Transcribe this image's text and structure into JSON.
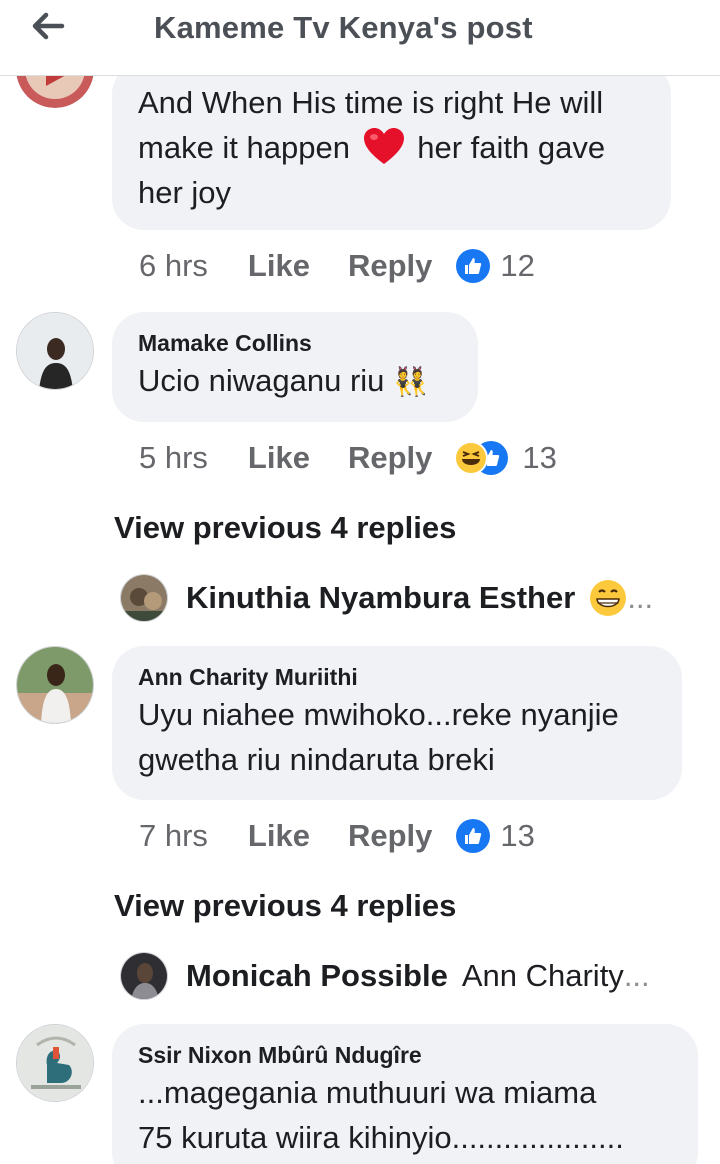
{
  "header": {
    "title": "Kameme Tv Kenya's post"
  },
  "comments": [
    {
      "text_lines": [
        "And When His time is right He will",
        "make it happen",
        "her faith gave",
        "her joy"
      ],
      "time": "6 hrs",
      "like": "Like",
      "reply": "Reply",
      "reaction_count": "12"
    },
    {
      "author": "Mamake Collins",
      "text": "Ucio niwaganu riu",
      "time": "5 hrs",
      "like": "Like",
      "reply": "Reply",
      "reaction_count": "13"
    },
    {
      "author": "Ann Charity Muriithi",
      "text_lines": [
        "Uyu niahee mwihoko...reke nyanjie",
        "gwetha riu nindaruta breki"
      ],
      "time": "7 hrs",
      "like": "Like",
      "reply": "Reply",
      "reaction_count": "13"
    },
    {
      "author": "Ssir Nixon Mbûrû Ndugîre",
      "text_lines": [
        "...magegania muthuuri wa miama",
        "75 kuruta wiira kihinyio...................."
      ]
    }
  ],
  "view_previous": [
    "View previous 4 replies",
    "View previous 4 replies"
  ],
  "reply_previews": [
    {
      "name": "Kinuthia Nyambura Esther",
      "more": "..."
    },
    {
      "name": "Monicah Possible",
      "snippet": "Ann Charity",
      "more": "..."
    }
  ],
  "colors": {
    "like_blue": "#1877f2",
    "bubble_bg": "#f0f2f5",
    "meta_gray": "#65676b"
  }
}
